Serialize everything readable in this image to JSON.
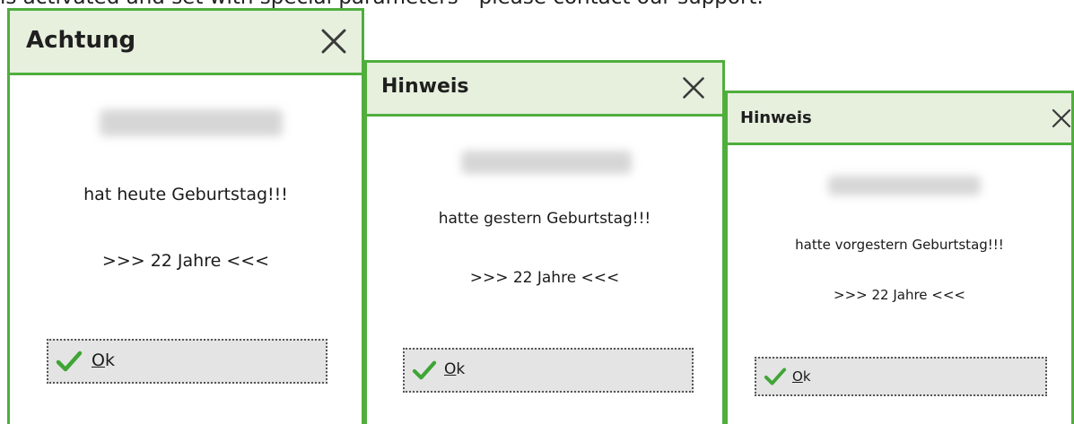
{
  "background_text": "is activated and set with special parameters - please contact our support.",
  "colors": {
    "accent_border": "#4fae3c",
    "titlebar_bg": "#e6f0dd",
    "check_green": "#3fa535",
    "button_bg": "#e4e4e4"
  },
  "dialogs": [
    {
      "title": "Achtung",
      "close_icon": "close-icon",
      "message": "hat heute Geburtstag!!!",
      "age": ">>> 22 Jahre <<<",
      "ok_button": {
        "icon": "check-icon",
        "label_mnemonic": "O",
        "label_rest": "k"
      }
    },
    {
      "title": "Hinweis",
      "close_icon": "close-icon",
      "message": "hatte gestern Geburtstag!!!",
      "age": ">>> 22 Jahre <<<",
      "ok_button": {
        "icon": "check-icon",
        "label_mnemonic": "O",
        "label_rest": "k"
      }
    },
    {
      "title": "Hinweis",
      "close_icon": "close-icon",
      "message": "hatte vorgestern Geburtstag!!!",
      "age": ">>> 22 Jahre <<<",
      "ok_button": {
        "icon": "check-icon",
        "label_mnemonic": "O",
        "label_rest": "k"
      }
    }
  ]
}
